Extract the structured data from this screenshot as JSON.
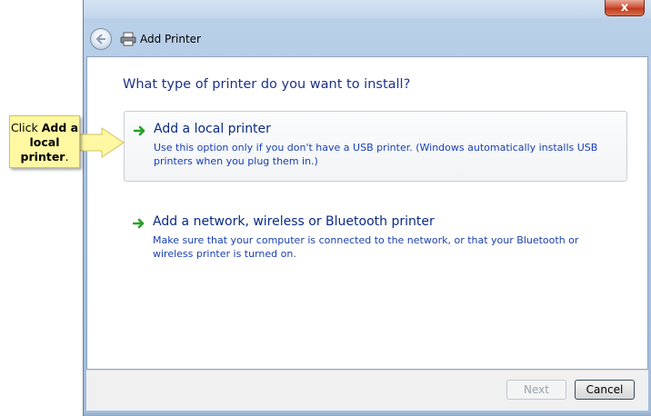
{
  "window": {
    "title": "Add Printer",
    "close_label": "x"
  },
  "page": {
    "question": "What type of printer do you want to install?"
  },
  "options": [
    {
      "title": "Add a local printer",
      "description": "Use this option only if you don't have a USB printer. (Windows automatically installs USB printers when you plug them in.)",
      "selected": true
    },
    {
      "title": "Add a network, wireless or Bluetooth printer",
      "description": "Make sure that your computer is connected to the network, or that your Bluetooth or wireless printer is turned on.",
      "selected": false
    }
  ],
  "buttons": {
    "next": "Next",
    "cancel": "Cancel"
  },
  "callout": {
    "prefix": "Click ",
    "bold_text": "Add a local printer",
    "suffix": "."
  },
  "colors": {
    "heading": "#1e3287",
    "link_title": "#0a2a85",
    "link_desc": "#1a3fb0",
    "arrow_green": "#2aa02a",
    "callout_bg": "#fff8a3"
  },
  "icons": {
    "back": "back-arrow-icon",
    "printer": "printer-icon",
    "option_arrow": "green-arrow-icon"
  }
}
